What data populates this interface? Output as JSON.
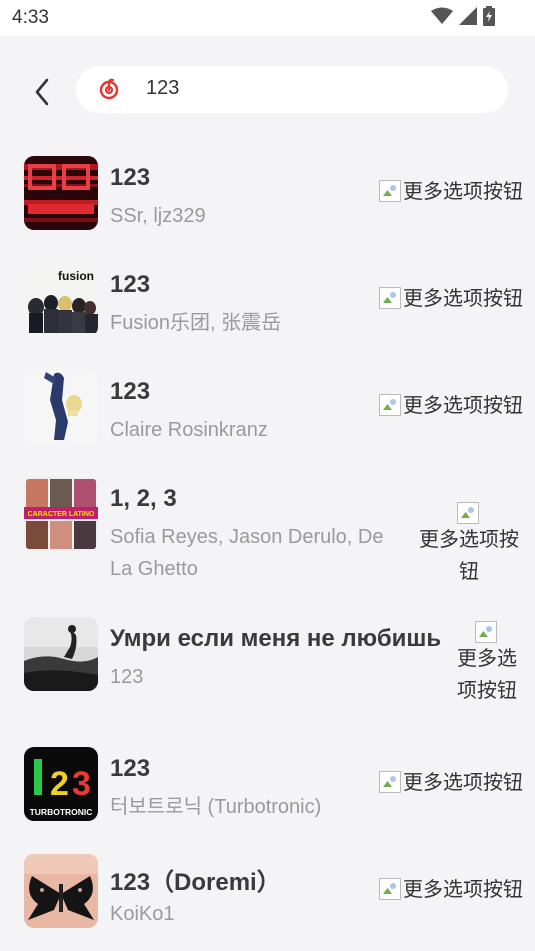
{
  "status_bar": {
    "time": "4:33"
  },
  "search": {
    "query": "123"
  },
  "colors": {
    "accent": "#e8342f",
    "background": "#f4f4f6",
    "secondary_text": "#9a9a9a"
  },
  "results": [
    {
      "title": "123",
      "artist": "SSr, ljz329",
      "more": "更多选项按钮"
    },
    {
      "title": "123",
      "artist": "Fusion乐团, 张震岳",
      "more": "更多选项按钮"
    },
    {
      "title": "123",
      "artist": "Claire Rosinkranz",
      "more": "更多选项按钮"
    },
    {
      "title": "1, 2, 3",
      "artist": "Sofia Reyes, Jason Derulo, De La Ghetto",
      "more": "更多选项按钮"
    },
    {
      "title": "Умри если меня не любишь",
      "artist": "123",
      "more": "更多选项按钮"
    },
    {
      "title": "123",
      "artist": "터보트로닉 (Turbotronic)",
      "more": "更多选项按钮"
    },
    {
      "title": "123（Doremi）",
      "artist": "KoiKo1",
      "more": "更多选项按钮"
    }
  ],
  "cover_texts": {
    "fusion": "fusion",
    "turbotronic": "TURBOTRONIC",
    "caracter": "CARACTER LATINO"
  }
}
